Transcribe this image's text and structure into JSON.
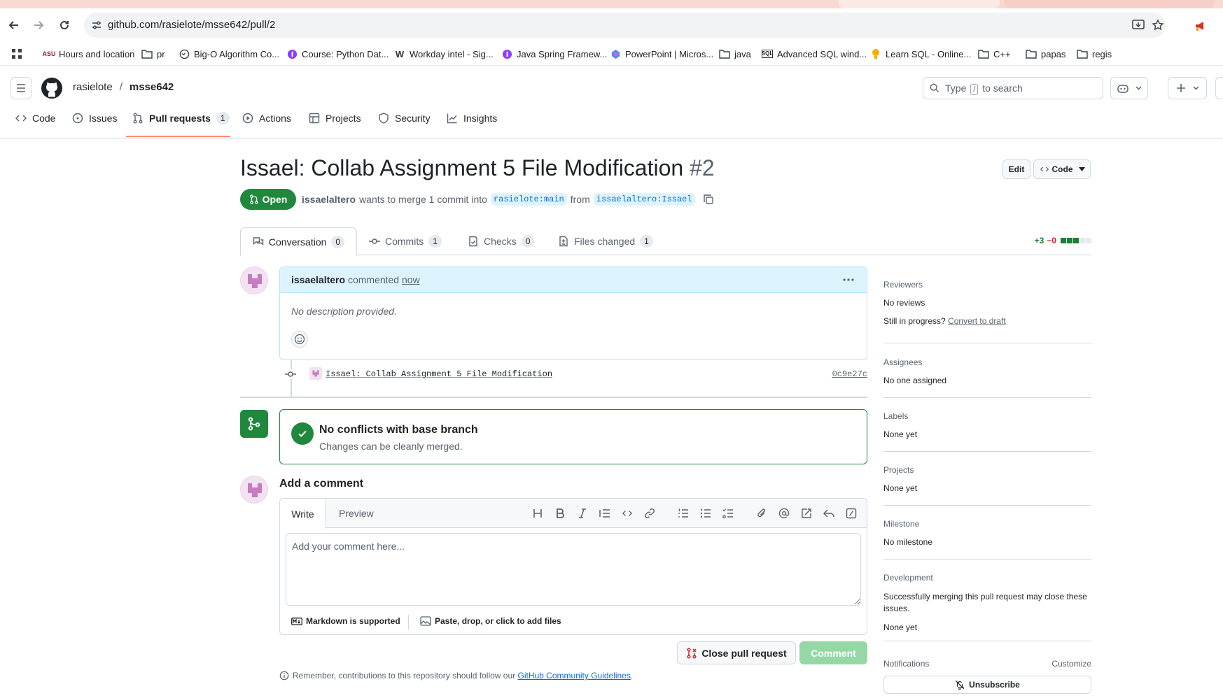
{
  "browser": {
    "url": "github.com/rasielote/msse642/pull/2",
    "bookmarks": [
      {
        "label": "Hours and location",
        "icon": "asu-logo-icon"
      },
      {
        "label": "pr",
        "icon": "folder-icon"
      },
      {
        "label": "Big-O Algorithm Co...",
        "icon": "globe-icon"
      },
      {
        "label": "Course: Python Dat...",
        "icon": "course-icon"
      },
      {
        "label": "Workday intel - Sig...",
        "icon": "workday-icon"
      },
      {
        "label": "Java Spring Framew...",
        "icon": "course-icon"
      },
      {
        "label": "PowerPoint | Micros...",
        "icon": "copilot-icon"
      },
      {
        "label": "java",
        "icon": "folder-icon"
      },
      {
        "label": "Advanced SQL wind...",
        "icon": "sql-icon"
      },
      {
        "label": "Learn SQL - Online...",
        "icon": "bulb-icon"
      },
      {
        "label": "C++",
        "icon": "folder-icon"
      },
      {
        "label": "papas",
        "icon": "folder-icon"
      },
      {
        "label": "regis",
        "icon": "folder-icon"
      }
    ]
  },
  "header": {
    "owner": "rasielote",
    "separator": "/",
    "repo": "msse642",
    "search_placeholder_pre": "Type",
    "search_key": "/",
    "search_placeholder_post": "to search"
  },
  "repo_nav": [
    {
      "label": "Code",
      "icon": "code-icon"
    },
    {
      "label": "Issues",
      "icon": "issue-icon"
    },
    {
      "label": "Pull requests",
      "icon": "pull-request-icon",
      "count": "1"
    },
    {
      "label": "Actions",
      "icon": "play-icon"
    },
    {
      "label": "Projects",
      "icon": "table-icon"
    },
    {
      "label": "Security",
      "icon": "shield-icon"
    },
    {
      "label": "Insights",
      "icon": "graph-icon"
    }
  ],
  "pr": {
    "title": "Issael: Collab Assignment 5 File Modification",
    "number": "#2",
    "edit_label": "Edit",
    "code_label": "Code",
    "state": "Open",
    "author": "issaelaltero",
    "meta_text": "wants to merge 1 commit into",
    "base_branch": "rasielote:main",
    "from_text": "from",
    "head_branch": "issaelaltero:Issael"
  },
  "tabs": [
    {
      "label": "Conversation",
      "count": "0",
      "icon": "comment-discussion-icon"
    },
    {
      "label": "Commits",
      "count": "1",
      "icon": "git-commit-icon"
    },
    {
      "label": "Checks",
      "count": "0",
      "icon": "checklist-icon"
    },
    {
      "label": "Files changed",
      "count": "1",
      "icon": "file-diff-icon"
    }
  ],
  "diffstat": {
    "additions": "+3",
    "deletions": "−0",
    "green_blocks": 3,
    "grey_blocks": 2,
    "add_color": "#1a7f37",
    "del_color": "#d1242f"
  },
  "comment": {
    "author": "issaelaltero",
    "action": "commented",
    "time": "now",
    "body": "No description provided."
  },
  "commit": {
    "message": "Issael: Collab Assignment 5 File Modification",
    "sha": "0c9e27c"
  },
  "merge_status": {
    "title": "No conflicts with base branch",
    "subtitle": "Changes can be cleanly merged."
  },
  "editor": {
    "heading": "Add a comment",
    "write_tab": "Write",
    "preview_tab": "Preview",
    "placeholder": "Add your comment here...",
    "markdown_note": "Markdown is supported",
    "attach_note": "Paste, drop, or click to add files",
    "close_button": "Close pull request",
    "comment_button": "Comment"
  },
  "guidelines": {
    "prefix": "Remember, contributions to this repository should follow our",
    "link": "GitHub Community Guidelines",
    "suffix": "."
  },
  "sidebar": {
    "reviewers_h": "Reviewers",
    "reviewers_v": "No reviews",
    "progress_q": "Still in progress?",
    "progress_link": "Convert to draft",
    "assignees_h": "Assignees",
    "assignees_v": "No one assigned",
    "labels_h": "Labels",
    "labels_v": "None yet",
    "projects_h": "Projects",
    "projects_v": "None yet",
    "milestone_h": "Milestone",
    "milestone_v": "No milestone",
    "development_h": "Development",
    "development_note": "Successfully merging this pull request may close these issues.",
    "development_v": "None yet",
    "notifications_h": "Notifications",
    "customize": "Customize",
    "unsubscribe": "Unsubscribe"
  },
  "colors": {
    "accent": "#0969da",
    "open_green": "#1f883d",
    "tab_underline": "#fd8c73",
    "comment_header": "#ddf4ff"
  }
}
